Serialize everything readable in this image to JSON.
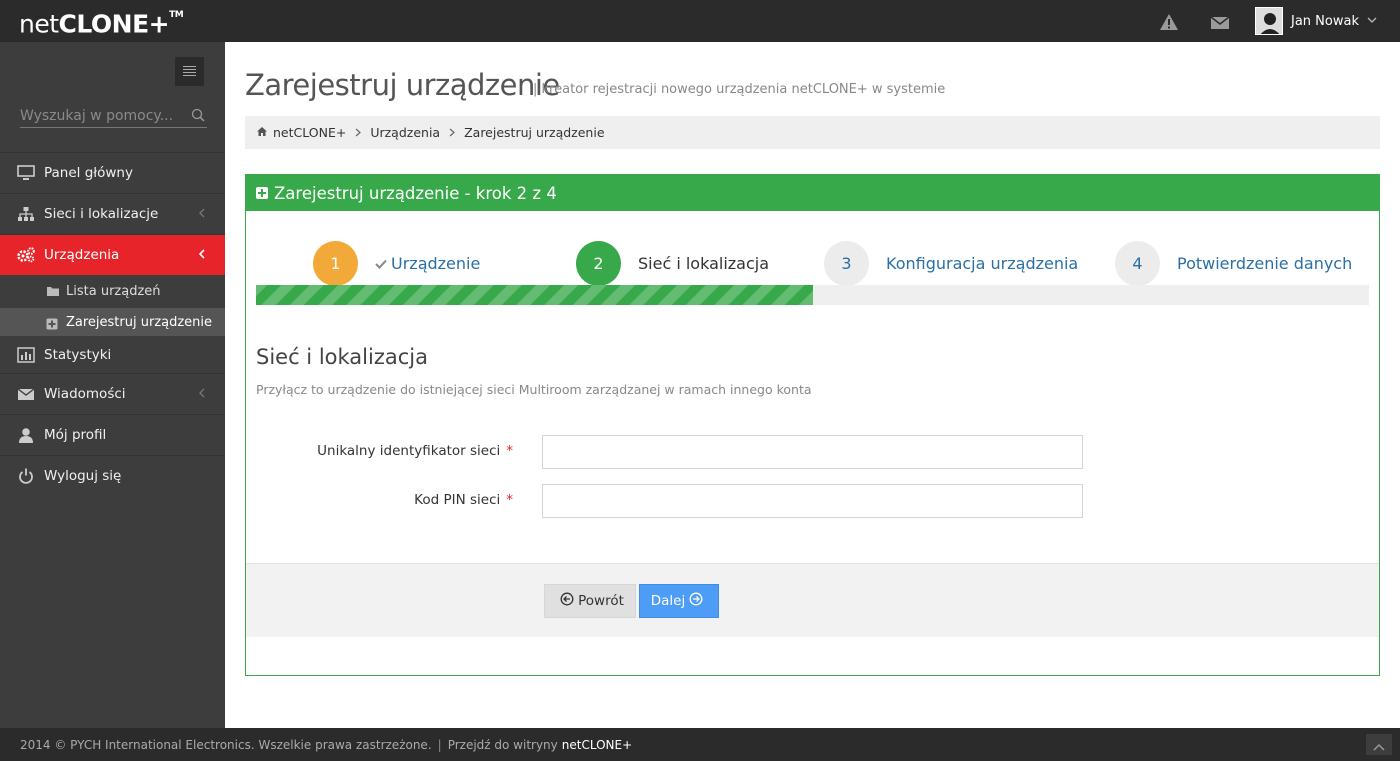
{
  "app": {
    "logo_light": "net",
    "logo_bold": "CLONE+",
    "logo_tm": "TM"
  },
  "topbar": {
    "user_name": "Jan Nowak",
    "icons": [
      "warning-icon",
      "envelope-icon"
    ]
  },
  "sidebar": {
    "search_placeholder": "Wyszukaj w pomocy...",
    "items": [
      {
        "label": "Panel główny",
        "icon": "monitor-icon"
      },
      {
        "label": "Sieci i lokalizacje",
        "icon": "sitemap-icon"
      },
      {
        "label": "Urządzenia",
        "icon": "cogs-icon",
        "active": true
      },
      {
        "label": "Statystyki",
        "icon": "bar-chart-icon"
      },
      {
        "label": "Wiadomości",
        "icon": "envelope-icon"
      },
      {
        "label": "Mój profil",
        "icon": "user-icon"
      },
      {
        "label": "Wyloguj się",
        "icon": "power-icon"
      }
    ],
    "subitems": [
      {
        "label": "Lista urządzeń",
        "icon": "folder-icon"
      },
      {
        "label": "Zarejestruj urządzenie",
        "icon": "plus-square-icon",
        "active": true
      }
    ]
  },
  "header": {
    "title": "Zarejestruj urządzenie",
    "subtitle": "| kreator rejestracji nowego urządzenia netCLONE+ w systemie"
  },
  "breadcrumb": [
    "netCLONE+",
    "Urządzenia",
    "Zarejestruj urządzenie"
  ],
  "wizard": {
    "title": "Zarejestruj urządzenie - krok 2 z 4",
    "progress": 0.5,
    "steps": [
      {
        "number": "1",
        "label": "Urządzenie",
        "state": "done"
      },
      {
        "number": "2",
        "label": "Sieć i lokalizacja",
        "state": "current"
      },
      {
        "number": "3",
        "label": "Konfiguracja urządzenia",
        "state": "todo"
      },
      {
        "number": "4",
        "label": "Potwierdzenie danych",
        "state": "todo"
      }
    ],
    "section_title": "Sieć i lokalizacja",
    "section_desc": "Przyłącz to urządzenie do istniejącej sieci Multiroom zarządzanej w ramach innego konta",
    "fields": [
      {
        "label": "Unikalny identyfikator sieci",
        "required": "*",
        "value": ""
      },
      {
        "label": "Kod PIN sieci",
        "required": "*",
        "value": ""
      }
    ],
    "back_label": "Powrót",
    "next_label": "Dalej"
  },
  "footer": {
    "copyright": "2014 © PYCH International Electronics. Wszelkie prawa zastrzeżone.",
    "link_prefix": "Przejdź do witryny",
    "link_brand": "netCLONE+"
  },
  "colors": {
    "accent_red": "#e6242a",
    "success_green": "#38a94a",
    "step_done": "#f3a93a",
    "primary_blue": "#4d9cf5"
  }
}
